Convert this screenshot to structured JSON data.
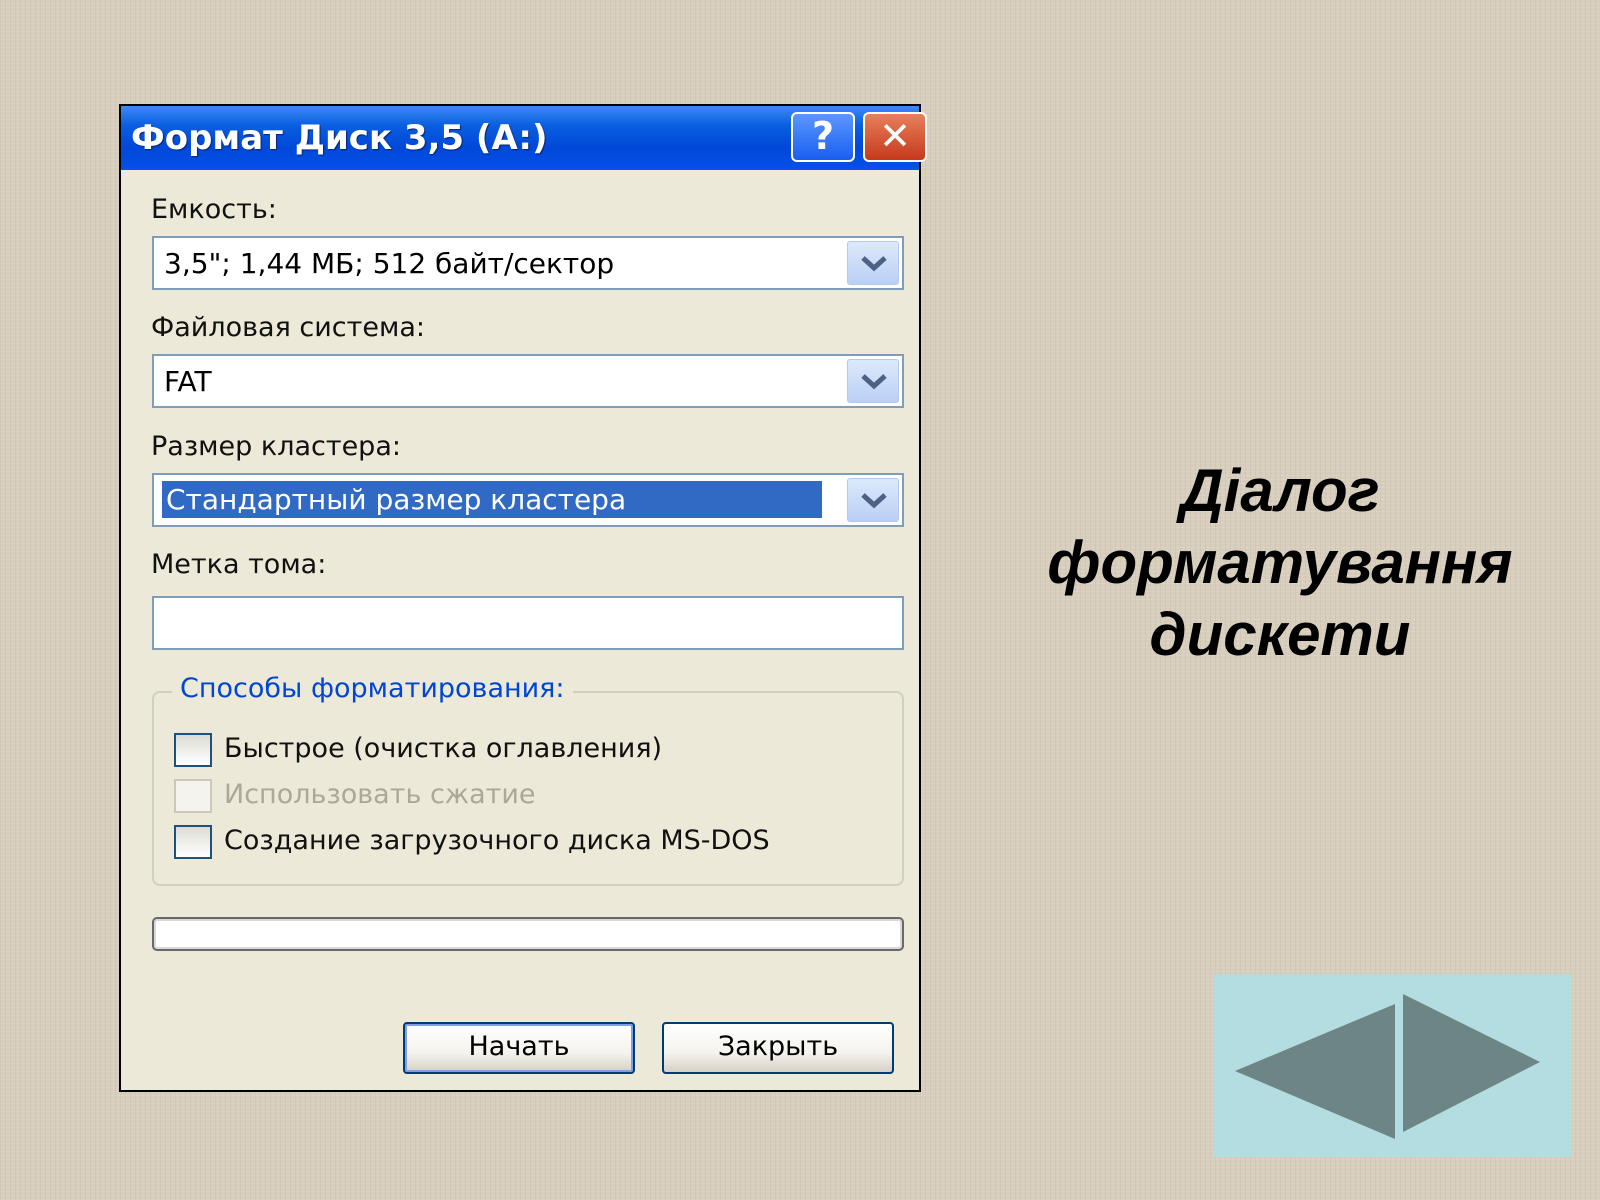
{
  "dialog": {
    "title": "Формат Диск 3,5 (A:)",
    "help_glyph": "?",
    "close_glyph": "✕",
    "capacity": {
      "label": "Емкость:",
      "value": "3,5\";  1,44 МБ; 512 байт/сектор"
    },
    "file_system": {
      "label": "Файловая система:",
      "value": "FAT"
    },
    "cluster_size": {
      "label": "Размер кластера:",
      "value": "Стандартный размер кластера"
    },
    "volume_label": {
      "label": "Метка тома:",
      "value": ""
    },
    "format_options": {
      "title": "Способы форматирования:",
      "options": [
        {
          "label": "Быстрое (очистка оглавления)",
          "checked": false,
          "enabled": true
        },
        {
          "label": "Использовать сжатие",
          "checked": false,
          "enabled": false
        },
        {
          "label": "Создание загрузочного диска MS-DOS",
          "checked": false,
          "enabled": true
        }
      ]
    },
    "progress": 0,
    "buttons": {
      "start": "Начать",
      "close": "Закрыть"
    }
  },
  "slide": {
    "caption": [
      "Діалог",
      "форматування",
      "дискети"
    ],
    "nav": {
      "prev_icon": "left-triangle-icon",
      "next_icon": "right-triangle-icon"
    }
  },
  "colors": {
    "titlebar": "#0a5fe0",
    "selection": "#316ac5",
    "group_title": "#0046d5",
    "nav_panel": "#b3dde0",
    "nav_arrow": "#6e8585"
  }
}
